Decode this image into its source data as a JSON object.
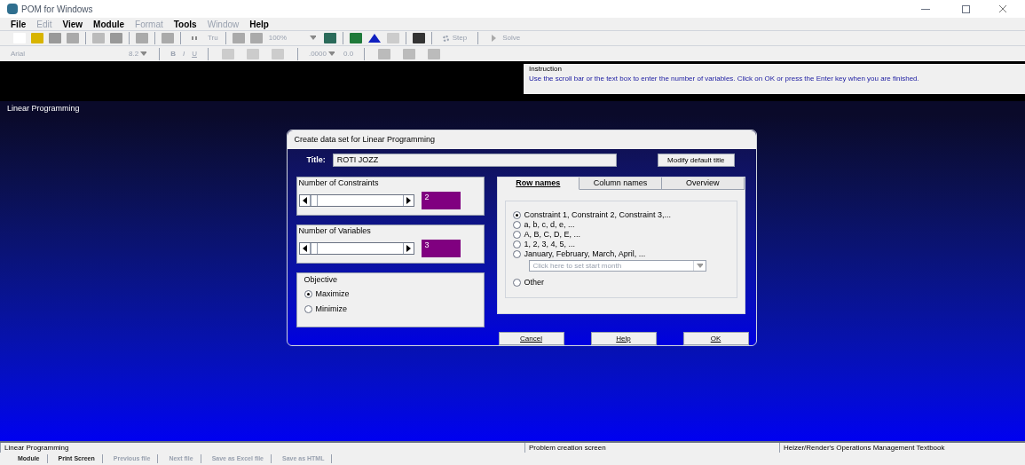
{
  "window": {
    "title": "POM for Windows"
  },
  "menu": [
    {
      "label": "File",
      "disabled": false
    },
    {
      "label": "Edit",
      "disabled": true
    },
    {
      "label": "View",
      "disabled": false
    },
    {
      "label": "Module",
      "disabled": false
    },
    {
      "label": "Format",
      "disabled": true
    },
    {
      "label": "Tools",
      "disabled": false
    },
    {
      "label": "Window",
      "disabled": true
    },
    {
      "label": "Help",
      "disabled": false
    }
  ],
  "toolbar": {
    "tru": "Tru",
    "zoom": "100%",
    "step": "Step",
    "solve": "Solve"
  },
  "format_bar": {
    "font": "Arial",
    "size": "8.2",
    "bold": "B",
    "italic": "I",
    "underline": "U",
    "decimals": ".0000",
    "fixed": "0.0"
  },
  "instruction": {
    "label": "Instruction",
    "text": "Use the scroll bar or the text box to enter the number of variables. Click on OK or press the Enter key when you are finished."
  },
  "workspace": {
    "label": "Linear Programming"
  },
  "dialog": {
    "title": "Create data set for Linear Programming",
    "title_label": "Title:",
    "title_value": "ROTI JOZZ",
    "modify_button": "Modify default title",
    "constraints": {
      "label": "Number of Constraints",
      "value": "2"
    },
    "variables": {
      "label": "Number of Variables",
      "value": "3"
    },
    "objective": {
      "label": "Objective",
      "options": [
        {
          "label": "Maximize",
          "selected": true
        },
        {
          "label": "Minimize",
          "selected": false
        }
      ]
    },
    "tabs": [
      {
        "label": "Row names",
        "selected": true
      },
      {
        "label": "Column names",
        "selected": false
      },
      {
        "label": "Overview",
        "selected": false
      }
    ],
    "row_options": [
      {
        "label": "Constraint 1, Constraint 2, Constraint 3,...",
        "selected": true
      },
      {
        "label": "a, b, c, d, e, ...",
        "selected": false
      },
      {
        "label": "A, B, C, D, E, ...",
        "selected": false
      },
      {
        "label": "1, 2, 3, 4, 5, ...",
        "selected": false
      },
      {
        "label": "January, February, March, April, ...",
        "selected": false
      },
      {
        "label": "Other",
        "selected": false
      }
    ],
    "month_placeholder": "Click here to set start month",
    "buttons": [
      "Cancel",
      "Help",
      "OK"
    ]
  },
  "status_bar": [
    "Linear Programming",
    "Problem creation screen",
    "Heizer/Render's Operations Management Textbook"
  ],
  "bottom_toolbar": [
    {
      "label": "Module",
      "disabled": false
    },
    {
      "label": "Print Screen",
      "disabled": false
    },
    {
      "label": "Previous file",
      "disabled": true
    },
    {
      "label": "Next file",
      "disabled": true
    },
    {
      "label": "Save as Excel file",
      "disabled": true
    },
    {
      "label": "Save as HTML",
      "disabled": true
    }
  ]
}
